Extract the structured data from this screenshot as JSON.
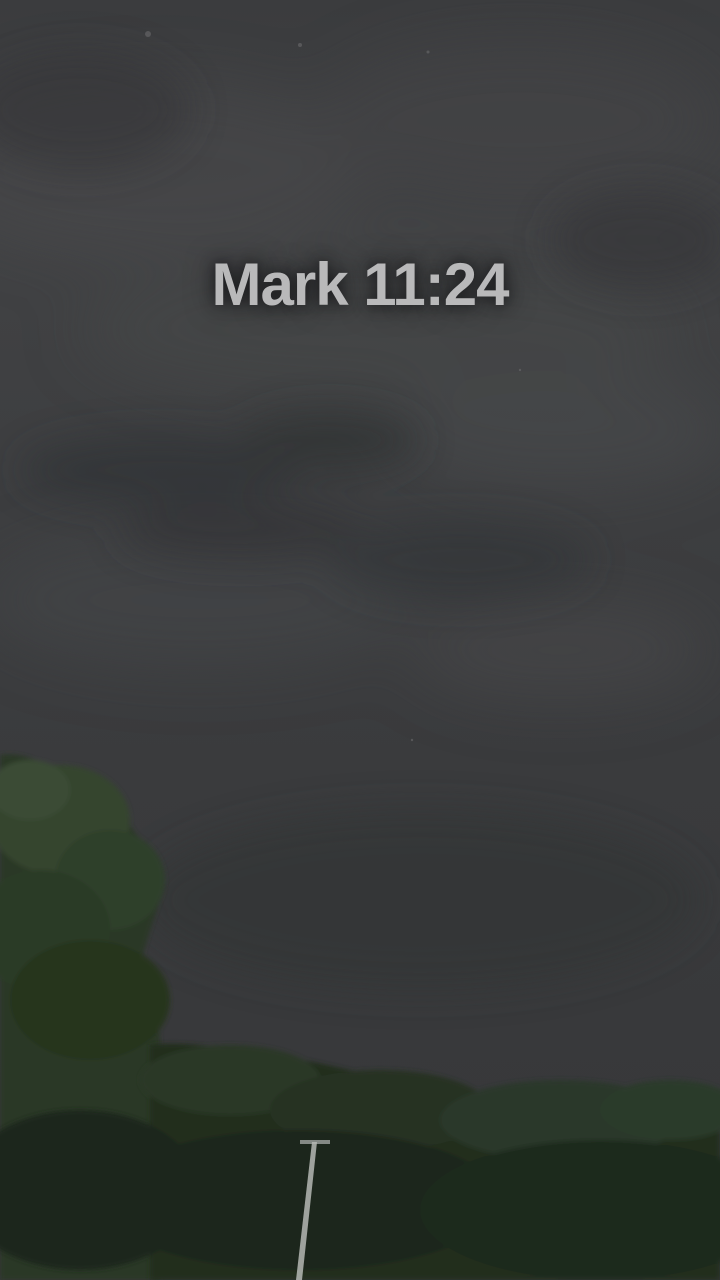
{
  "video": {
    "caption": "Mark 11:24"
  },
  "scene": {
    "sky_description_colors": {
      "sky_top": "#3b3c3e",
      "sky_bottom": "#363739",
      "cloud_dark": "#2e3033",
      "cloud_light": "#4a4b4d",
      "foliage_dark": "#1f2a1d",
      "foliage_mid": "#2c3a28",
      "foliage_light": "#3d4d36",
      "caption_color": "#b9b9ba"
    }
  }
}
